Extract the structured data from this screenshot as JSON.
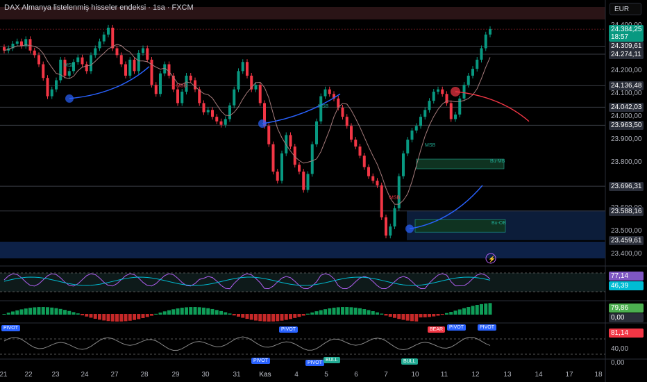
{
  "header": {
    "title": "DAX Almanya listelenmiş hisseler endeksi · 1sa · FXCM",
    "currency": "EUR",
    "alert_icon": "lightning-icon"
  },
  "chart_data": {
    "type": "candlestick",
    "title": "DAX Almanya listelenmiş hisseler endeksi · 1sa · FXCM",
    "ylim": [
      23350,
      24420
    ],
    "y_ticks": [
      "24.400,00",
      "24.300,00",
      "24.200,00",
      "24.100,00",
      "24.000,00",
      "23.900,00",
      "23.800,00",
      "23.700,00",
      "23.600,00",
      "23.500,00",
      "23.400,00"
    ],
    "x_ticks": [
      "21",
      "22",
      "23",
      "24",
      "27",
      "28",
      "29",
      "30",
      "31",
      "Kas",
      "4",
      "5",
      "6",
      "7",
      "10",
      "11",
      "12",
      "13",
      "14",
      "17",
      "18"
    ],
    "price_labels": [
      {
        "text": "24.384,25",
        "value": 24384,
        "color": "#089981"
      },
      {
        "text": "18:57",
        "value": 24350,
        "color": "#089981"
      },
      {
        "text": "24.309,61",
        "value": 24310,
        "color": "#2a2e39"
      },
      {
        "text": "24.274,11",
        "value": 24274,
        "color": "#2a2e39"
      },
      {
        "text": "24.136,48",
        "value": 24136,
        "color": "#2a2e39"
      },
      {
        "text": "24.042,03",
        "value": 24042,
        "color": "#2a2e39"
      },
      {
        "text": "23.963,50",
        "value": 23963,
        "color": "#2a2e39"
      },
      {
        "text": "23.696,31",
        "value": 23696,
        "color": "#2a2e39"
      },
      {
        "text": "23.588,16",
        "value": 23588,
        "color": "#2a2e39"
      },
      {
        "text": "23.459,61",
        "value": 23460,
        "color": "#2a2e39"
      }
    ],
    "closes": [
      24290,
      24300,
      24320,
      24330,
      24310,
      24340,
      24290,
      24270,
      24230,
      24170,
      24090,
      24120,
      24160,
      24250,
      24180,
      24200,
      24240,
      24260,
      24230,
      24200,
      24270,
      24300,
      24330,
      24360,
      24390,
      24300,
      24270,
      24230,
      24180,
      24250,
      24200,
      24280,
      24300,
      24250,
      24140,
      24100,
      24190,
      24230,
      24180,
      24120,
      24060,
      24110,
      24180,
      24160,
      24120,
      24060,
      24020,
      24030,
      24000,
      23980,
      23965,
      23990,
      24050,
      24120,
      24200,
      24240,
      24180,
      24120,
      24140,
      24060,
      23960,
      23880,
      23760,
      23720,
      23840,
      23920,
      23870,
      23790,
      23760,
      23680,
      23750,
      23880,
      23980,
      24090,
      24120,
      24100,
      24080,
      24040,
      24000,
      23960,
      23900,
      23870,
      23830,
      23780,
      23740,
      23720,
      23700,
      23560,
      23480,
      23520,
      23600,
      23740,
      23840,
      23900,
      23940,
      23960,
      24000,
      24030,
      24070,
      24110,
      24120,
      24100,
      24060,
      23990,
      24010,
      24080,
      24140,
      24180,
      24210,
      24250,
      24300,
      24360,
      24384
    ],
    "horizontal_levels": [
      24383,
      24309,
      24274,
      24136,
      24042,
      23963,
      23696,
      23588
    ],
    "labels": [
      {
        "text": "MSB",
        "color": "#22ab94"
      },
      {
        "text": "MSB",
        "color": "#f23645"
      },
      {
        "text": "MSB",
        "color": "#22ab94"
      },
      {
        "text": "MSB",
        "color": "#f23645"
      },
      {
        "text": "MSB",
        "color": "#22ab94"
      },
      {
        "text": "Bu-MB",
        "color": "#22ab94"
      },
      {
        "text": "Bu-OB",
        "color": "#22ab94"
      }
    ],
    "indicators": [
      {
        "name": "RSI",
        "labels": [
          {
            "text": "77,14",
            "color": "#7e57c2"
          },
          {
            "text": "46,39",
            "color": "#00bcd4"
          }
        ]
      },
      {
        "name": "Histogram",
        "labels": [
          {
            "text": "79,86",
            "color": "#4caf50"
          },
          {
            "text": "0,00",
            "color": "#2a2e39"
          }
        ]
      },
      {
        "name": "Oscillator",
        "labels": [
          {
            "text": "81,14",
            "color": "#f23645"
          }
        ],
        "axis": [
          "40,00",
          "0,00"
        ],
        "tags": [
          {
            "text": "PIVOT",
            "color": "#2962ff"
          },
          {
            "text": "PIVOT",
            "color": "#2962ff"
          },
          {
            "text": "BEAR",
            "color": "#f23645"
          },
          {
            "text": "PIVOT",
            "color": "#2962ff"
          },
          {
            "text": "PIVOT",
            "color": "#2962ff"
          },
          {
            "text": "PIVOT",
            "color": "#2962ff"
          },
          {
            "text": "PIVOT",
            "color": "#2962ff"
          },
          {
            "text": "BULL",
            "color": "#22ab94"
          },
          {
            "text": "BULL",
            "color": "#22ab94"
          }
        ]
      }
    ]
  }
}
